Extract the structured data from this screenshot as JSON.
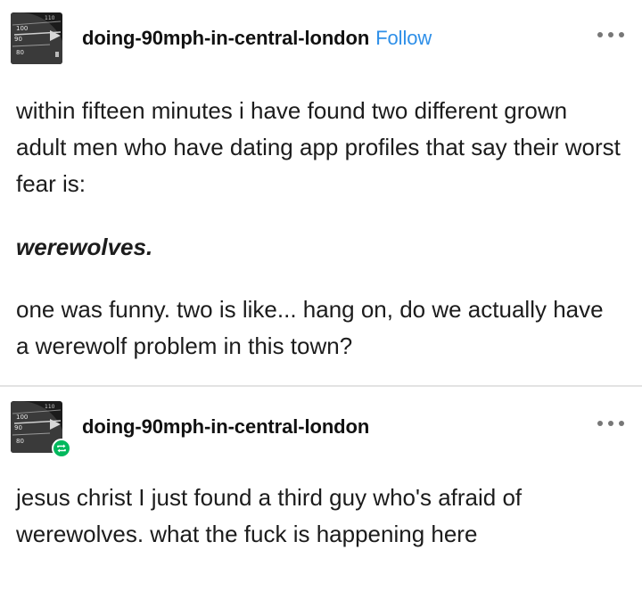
{
  "posts": [
    {
      "username": "doing-90mph-in-central-london",
      "follow_label": "Follow",
      "avatar_icon": "speedometer-icon",
      "more_icon": "ellipsis-icon",
      "paragraphs": [
        "within fifteen minutes i have found two different grown adult men who have dating app profiles that say their worst fear is:",
        "werewolves.",
        "one was funny. two is like... hang on, do we actually have a werewolf problem in this town?"
      ]
    },
    {
      "username": "doing-90mph-in-central-london",
      "avatar_icon": "speedometer-icon",
      "badge_icon": "reblog-icon",
      "more_icon": "ellipsis-icon",
      "paragraphs": [
        "jesus christ I just found a third guy who's afraid of werewolves. what the fuck is happening here"
      ]
    }
  ],
  "colors": {
    "follow": "#2e8fe8",
    "reblog_badge": "#00b85c",
    "divider": "#e3e3e3"
  }
}
